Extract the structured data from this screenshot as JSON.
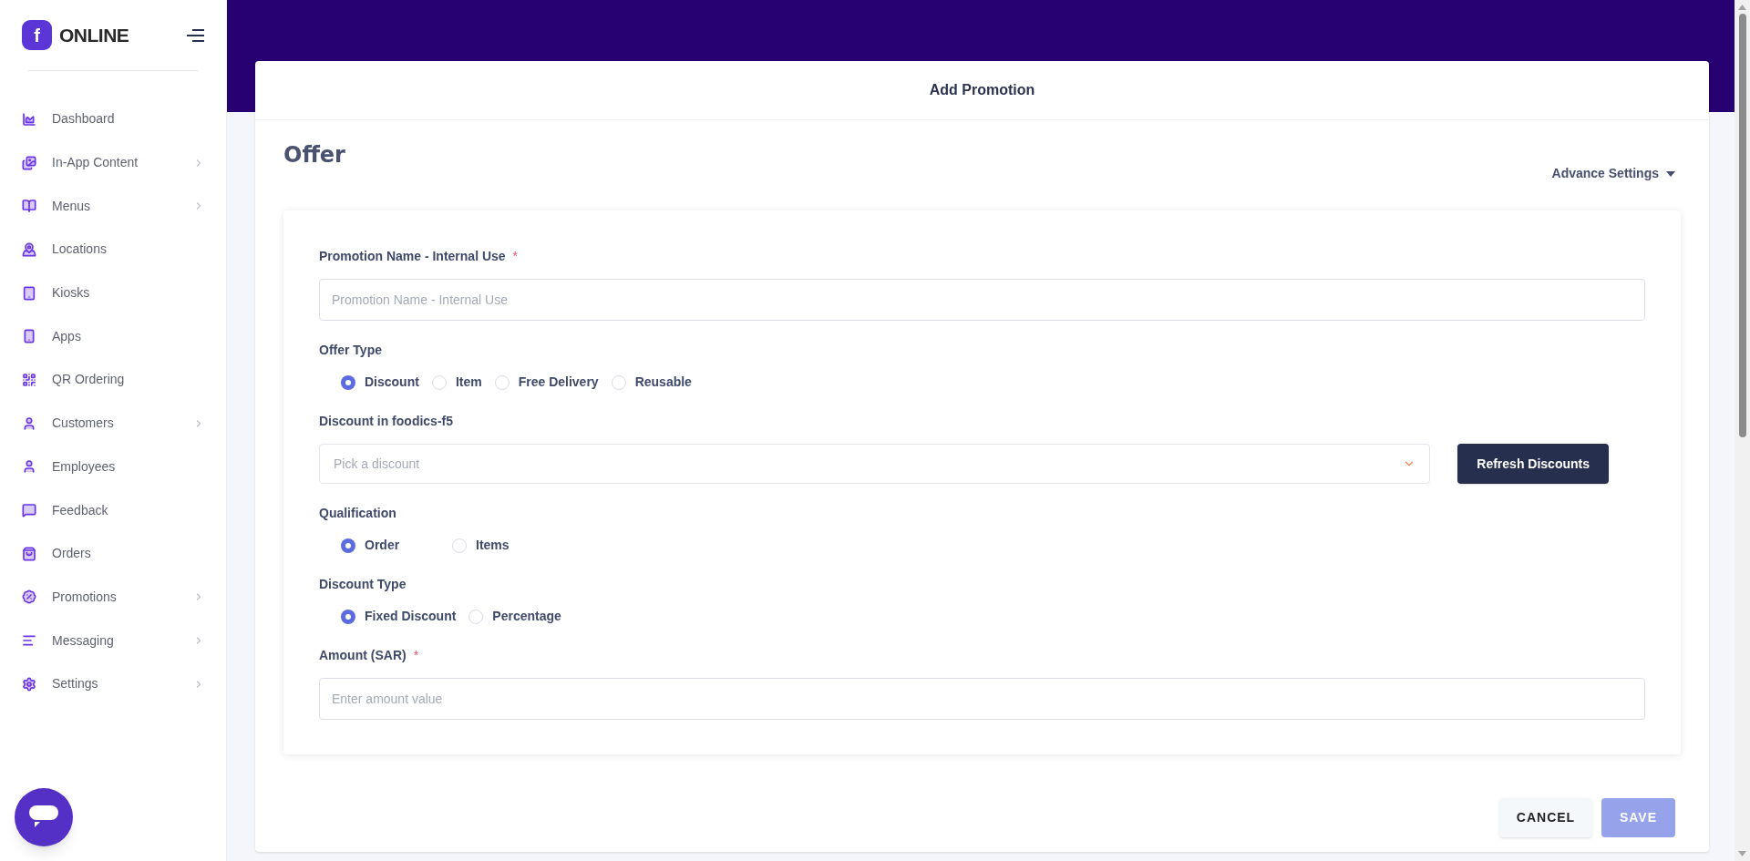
{
  "brand": {
    "logo_letter": "f",
    "name": "ONLINE"
  },
  "sidebar": {
    "items": [
      {
        "label": "Dashboard",
        "has_submenu": false
      },
      {
        "label": "In-App Content",
        "has_submenu": true
      },
      {
        "label": "Menus",
        "has_submenu": true
      },
      {
        "label": "Locations",
        "has_submenu": false
      },
      {
        "label": "Kiosks",
        "has_submenu": false
      },
      {
        "label": "Apps",
        "has_submenu": false
      },
      {
        "label": "QR Ordering",
        "has_submenu": false
      },
      {
        "label": "Customers",
        "has_submenu": true
      },
      {
        "label": "Employees",
        "has_submenu": false
      },
      {
        "label": "Feedback",
        "has_submenu": false
      },
      {
        "label": "Orders",
        "has_submenu": false
      },
      {
        "label": "Promotions",
        "has_submenu": true
      },
      {
        "label": "Messaging",
        "has_submenu": true
      },
      {
        "label": "Settings",
        "has_submenu": true
      }
    ]
  },
  "dialog": {
    "title": "Add Promotion",
    "section_title": "Offer",
    "advance_settings": "Advance Settings",
    "form": [
      {
        "kind": "text",
        "label": "Promotion Name - Internal Use",
        "required": true,
        "required_mark": "*",
        "placeholder": "Promotion Name - Internal Use"
      },
      {
        "kind": "radio",
        "label": "Offer Type",
        "options": [
          {
            "label": "Discount",
            "selected": true
          },
          {
            "label": "Item",
            "selected": false
          },
          {
            "label": "Free Delivery",
            "selected": false
          },
          {
            "label": "Reusable",
            "selected": false
          }
        ]
      },
      {
        "kind": "select",
        "label": "Discount in foodics-f5",
        "placeholder": "Pick a discount",
        "button": "Refresh Discounts"
      },
      {
        "kind": "radio",
        "label": "Qualification",
        "options": [
          {
            "label": "Order",
            "selected": true
          },
          {
            "label": "Items",
            "selected": false
          }
        ]
      },
      {
        "kind": "radio",
        "label": "Discount Type",
        "options": [
          {
            "label": "Fixed Discount",
            "selected": true
          },
          {
            "label": "Percentage",
            "selected": false
          }
        ]
      },
      {
        "kind": "text",
        "label": "Amount (SAR)",
        "required": true,
        "required_mark": "*",
        "placeholder": "Enter amount value"
      }
    ],
    "cancel": "CANCEL",
    "save": {
      "label": "SAVE",
      "disabled": true
    }
  }
}
